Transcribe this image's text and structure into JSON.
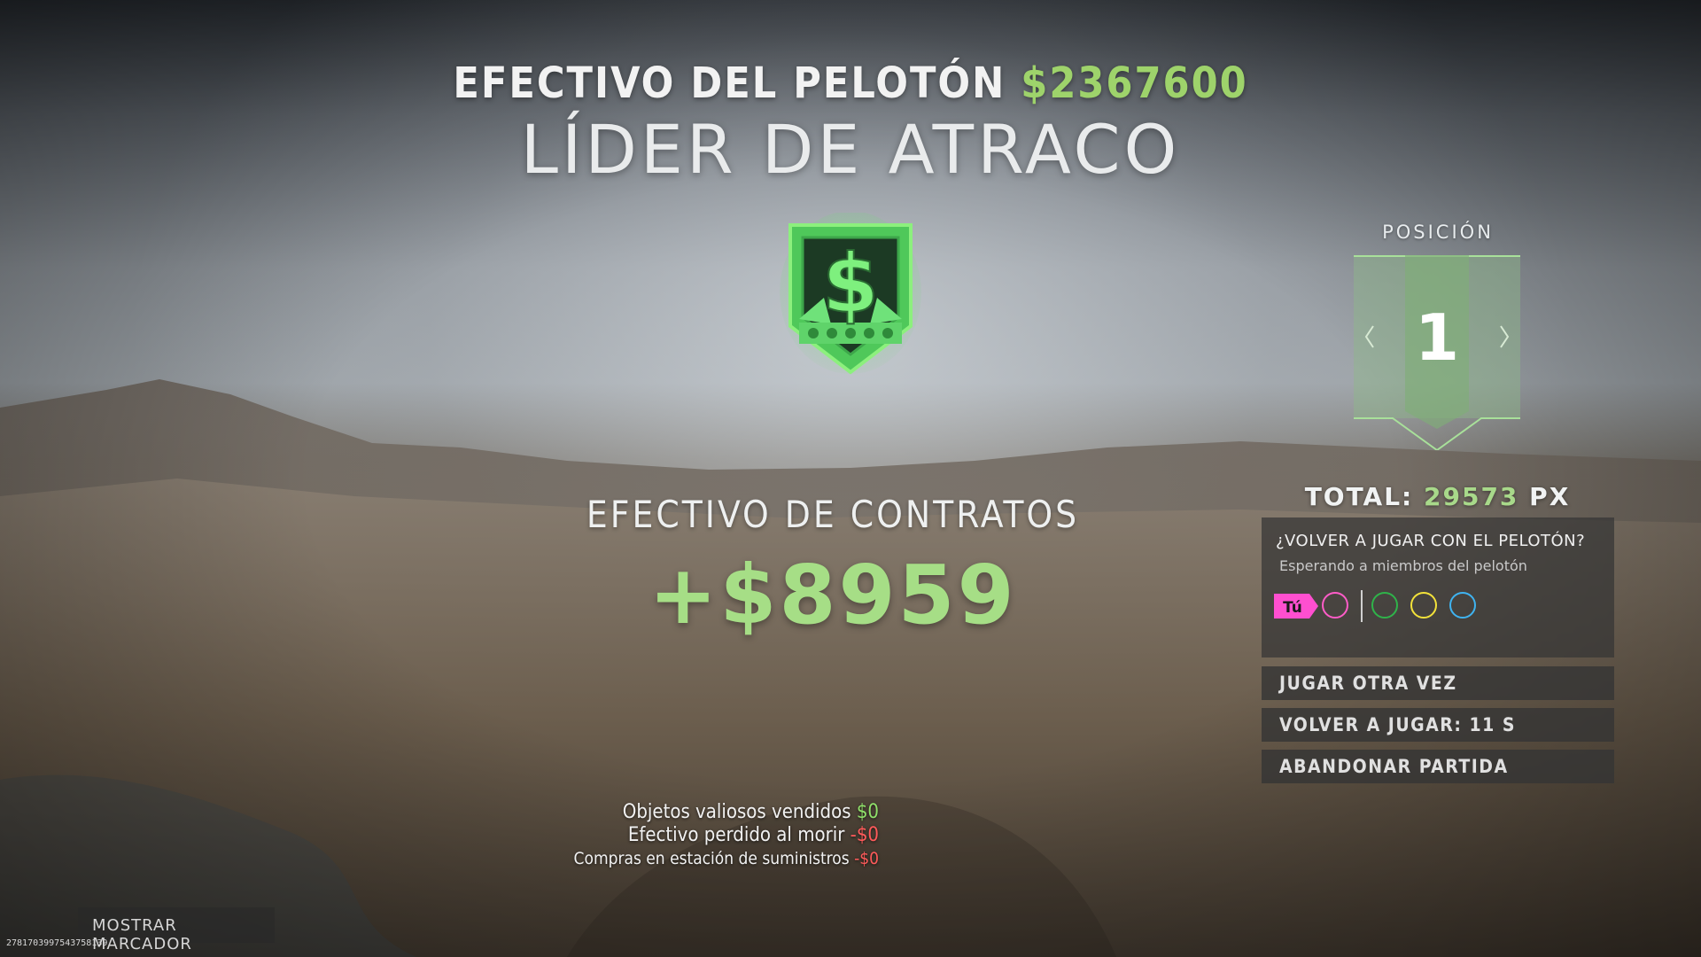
{
  "header": {
    "squad_cash_label": "EFECTIVO DEL PELOTÓN",
    "squad_cash_amount": "$2367600",
    "title": "LÍDER DE ATRACO"
  },
  "badge": {
    "icon": "dollar-shield-emblem",
    "symbol": "$",
    "color": "#5fd36a"
  },
  "contracts": {
    "label": "EFECTIVO DE CONTRATOS",
    "value": "+$8959"
  },
  "breakdown": [
    {
      "label": "Objetos valiosos vendidos",
      "value": "$0"
    },
    {
      "label": "Efectivo perdido al morir",
      "value": "-$0"
    },
    {
      "label": "Compras en estación de suministros",
      "value": "-$0"
    }
  ],
  "position": {
    "label": "POSICIÓN",
    "value": "1"
  },
  "total": {
    "label": "TOTAL:",
    "points": "29573",
    "unit": "PX"
  },
  "replay": {
    "question": "¿VOLVER A JUGAR CON EL PELOTÓN?",
    "status": "Esperando a miembros del pelotón",
    "you_label": "Tú",
    "members": [
      {
        "color": "#ff5cc8"
      },
      {
        "color": "#2fb34a"
      },
      {
        "color": "#f3e23a"
      },
      {
        "color": "#3fb3f0"
      }
    ]
  },
  "menu": {
    "play_again": "JUGAR OTRA VEZ",
    "replay_timer": "VOLVER A JUGAR: 11 S",
    "leave": "ABANDONAR PARTIDA"
  },
  "footer": {
    "scoreboard": "MOSTRAR MARCADOR",
    "session_id": "2781703997543758139"
  },
  "colors": {
    "accent_green": "#9ed36b",
    "negative": "#ff5a5a",
    "you_tag": "#ff4fd0"
  }
}
